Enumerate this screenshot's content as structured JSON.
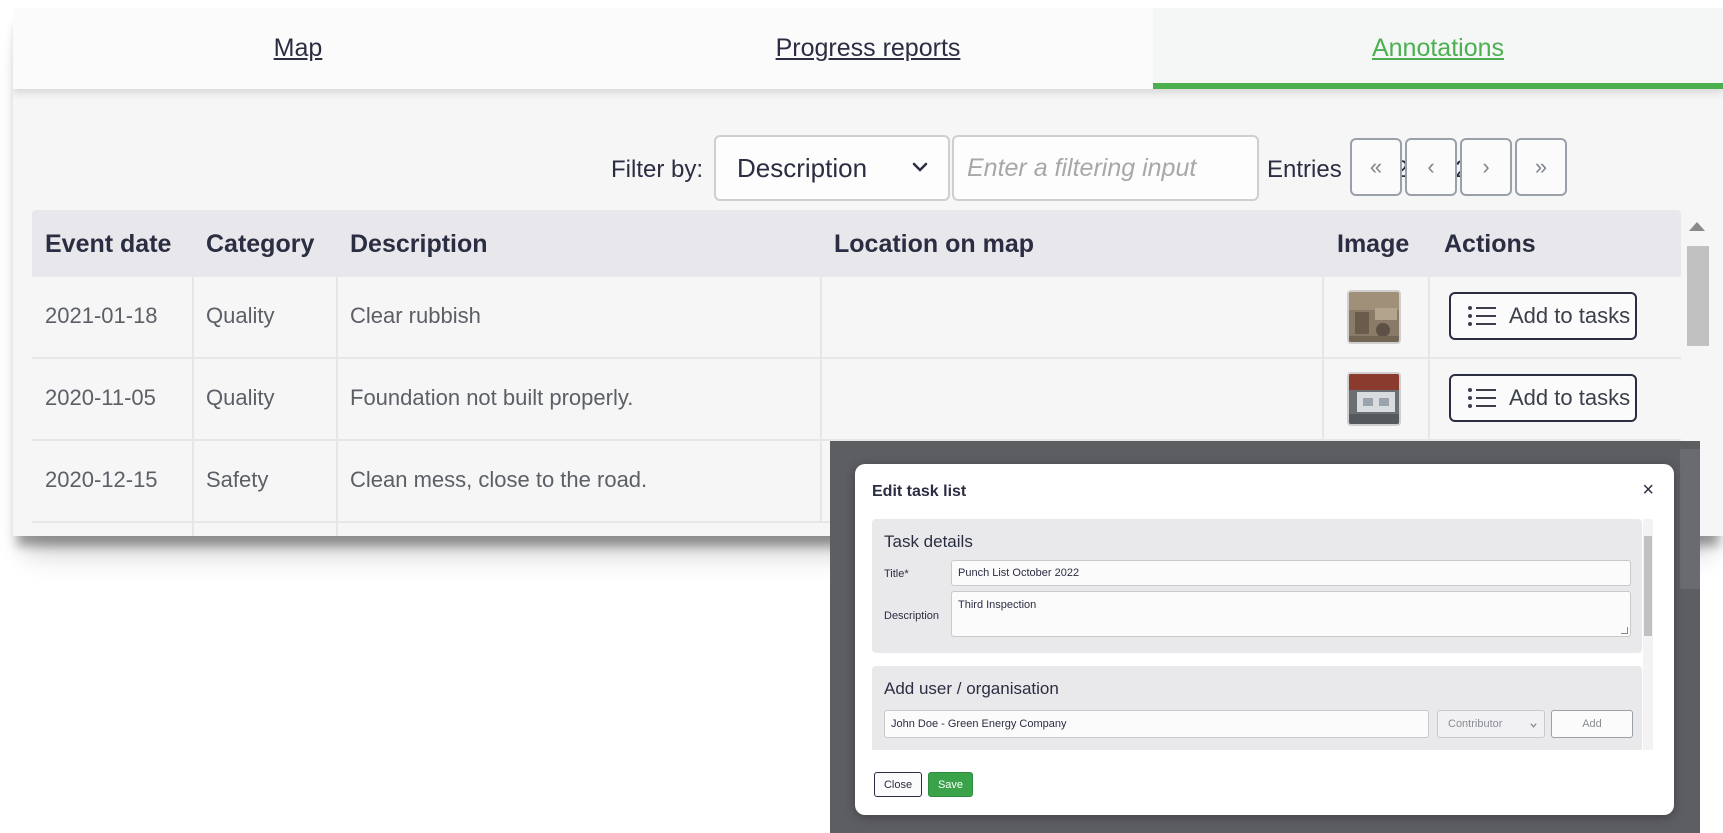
{
  "tabs": [
    {
      "label": "Map",
      "active": false
    },
    {
      "label": "Progress reports",
      "active": false
    },
    {
      "label": "Annotations",
      "active": true
    }
  ],
  "filter": {
    "label": "Filter by:",
    "selected": "Description",
    "placeholder": "Enter a filtering input",
    "entries_text": "Entries 1 to 25 of 25"
  },
  "pagination": {
    "first": "«",
    "prev": "‹",
    "next": "›",
    "last": "»"
  },
  "table": {
    "headers": [
      "Event date",
      "Category",
      "Description",
      "Location on map",
      "Image",
      "Actions"
    ],
    "rows": [
      {
        "date": "2021-01-18",
        "category": "Quality",
        "description": "Clear rubbish",
        "location": "",
        "action": "Add to tasks"
      },
      {
        "date": "2020-11-05",
        "category": "Quality",
        "description": "Foundation not built properly.",
        "location": "",
        "action": "Add to tasks"
      },
      {
        "date": "2020-12-15",
        "category": "Safety",
        "description": "Clean mess, close to the road.",
        "location": "",
        "action": ""
      }
    ]
  },
  "modal": {
    "title": "Edit task list",
    "close_icon": "×",
    "task_details": {
      "heading": "Task details",
      "title_label": "Title*",
      "title_value": "Punch List October 2022",
      "description_label": "Description",
      "description_value": "Third Inspection"
    },
    "add_user": {
      "heading": "Add user / organisation",
      "user_value": "John Doe - Green Energy Company",
      "role_selected": "Contributor",
      "add_label": "Add"
    },
    "footer": {
      "close_label": "Close",
      "save_label": "Save"
    }
  },
  "colors": {
    "accent_green": "#4caf50",
    "text_dark": "#2b2d42",
    "save_green": "#3aa34a",
    "backdrop": "#5d5e62"
  }
}
